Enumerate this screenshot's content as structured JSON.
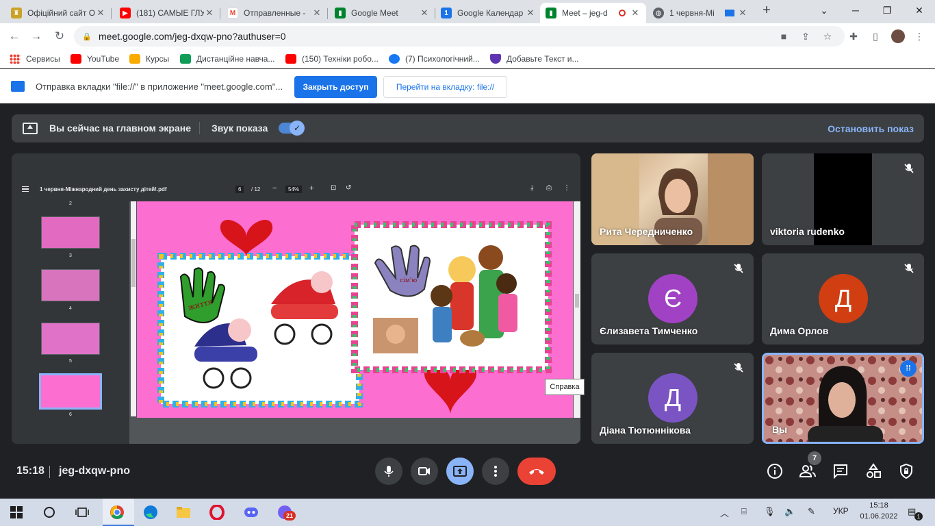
{
  "browser": {
    "tabs": [
      {
        "title": "Офіційний сайт О",
        "active": false
      },
      {
        "title": "(181) САМЫЕ ГЛУ",
        "active": false
      },
      {
        "title": "Отправленные - ",
        "active": false
      },
      {
        "title": "Google Meet",
        "active": false
      },
      {
        "title": "Google Календар",
        "active": false
      },
      {
        "title": "Meet – jeg-d",
        "active": true
      },
      {
        "title": "1 червня-Мі",
        "active": false
      }
    ],
    "new_tab": "+",
    "url": "meet.google.com/jeg-dxqw-pno?authuser=0",
    "bookmarks": [
      {
        "label": "Сервисы"
      },
      {
        "label": "YouTube"
      },
      {
        "label": "Курсы"
      },
      {
        "label": "Дистанційне навча..."
      },
      {
        "label": "(150) Техніки робо..."
      },
      {
        "label": "(7) Психологічний..."
      },
      {
        "label": "Добавьте Текст и..."
      }
    ],
    "infobar": {
      "message": "Отправка вкладки \"file://\" в приложение \"meet.google.com\"...",
      "primary": "Закрыть доступ",
      "secondary": "Перейти на вкладку: file://"
    }
  },
  "meet": {
    "presenting": {
      "status": "Вы сейчас на главном экране",
      "audio_label": "Звук показа",
      "audio_on": true,
      "stop": "Остановить показ"
    },
    "pdf": {
      "filename": "1 червня-Міжнародний день захисту дітей!.pdf",
      "page": "6",
      "total": "/ 12",
      "zoom": "54%",
      "thumbs": [
        {
          "label": "2"
        },
        {
          "label": "3"
        },
        {
          "label": "4"
        },
        {
          "label": "5"
        },
        {
          "label": "6"
        }
      ],
      "slide_text": [
        "життя",
        "сім'ю"
      ]
    },
    "tooltip": "Справка",
    "participants": [
      {
        "name": "Рита Чередниченко",
        "muted": false
      },
      {
        "name": "viktoria rudenko",
        "muted": true
      },
      {
        "name": "Єлизавета Тимченко",
        "initial": "Є",
        "color": "#a142c4",
        "muted": true
      },
      {
        "name": "Дима Орлов",
        "initial": "Д",
        "color": "#d13e12",
        "muted": true
      },
      {
        "name": "Діана Тютюннікова",
        "initial": "Д",
        "color": "#7b54c4",
        "muted": true
      },
      {
        "name": "Вы",
        "muted": false
      }
    ],
    "time": "15:18",
    "meeting_code": "jeg-dxqw-pno",
    "people_count": "7"
  },
  "taskbar": {
    "lang": "УКР",
    "time": "15:18",
    "date": "01.06.2022",
    "viber_badge": "21",
    "notif_badge": "1"
  },
  "colors": {
    "meet_bg": "#202124",
    "accent": "#8ab4f8",
    "hangup": "#ea4335",
    "present_active": "#8ab4f8"
  }
}
